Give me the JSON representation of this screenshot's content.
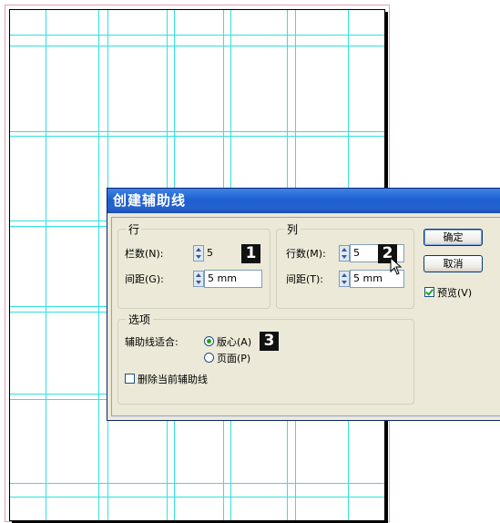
{
  "dialog": {
    "title": "创建辅助线",
    "rows": {
      "group_title": "行",
      "count_label": "栏数(N):",
      "count_value": "5",
      "gutter_label": "间距(G):",
      "gutter_value": "5 mm",
      "badge": "1"
    },
    "columns": {
      "group_title": "列",
      "count_label": "行数(M):",
      "count_value": "5",
      "gutter_label": "间距(T):",
      "gutter_value": "5 mm",
      "badge": "2"
    },
    "options": {
      "group_title": "选项",
      "fit_label": "辅助线适合:",
      "radio_margins": "版心(A)",
      "radio_page": "页面(P)",
      "remove_existing": "删除当前辅助线",
      "badge": "3"
    },
    "buttons": {
      "ok": "确定",
      "cancel": "取消",
      "preview": "预览(V)"
    }
  },
  "colors": {
    "guide": "#33e0e0",
    "margin_guide": "#a9a6e6",
    "titlebar": "#2562cf",
    "dialog_bg": "#ece9d8"
  }
}
